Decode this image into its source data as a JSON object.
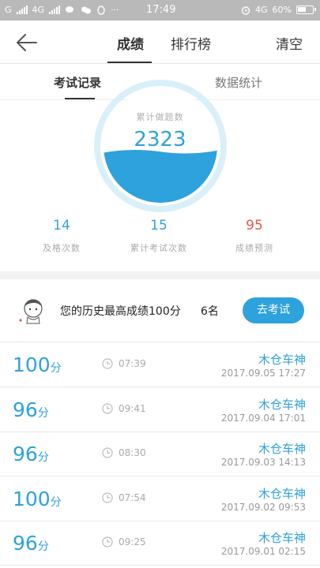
{
  "status_bar": {
    "carrier1": "G",
    "carrier2": "4G",
    "more": "···",
    "time": "17:49",
    "network": "4G",
    "battery": "60%"
  },
  "nav": {
    "tab_score": "成绩",
    "tab_rank": "排行榜",
    "clear": "清空"
  },
  "subtabs": {
    "records": "考试记录",
    "stats": "数据统计"
  },
  "gauge": {
    "label": "累计做题数",
    "value": "2323",
    "fill_level": 0.45,
    "color": "#2ea2dc"
  },
  "stats": [
    {
      "value": "14",
      "label": "及格次数",
      "color": "#2ea2dc"
    },
    {
      "value": "15",
      "label": "累计考试次数",
      "color": "#2ea2dc"
    },
    {
      "value": "95",
      "label": "成绩预测",
      "color": "#e25a4a"
    }
  ],
  "best": {
    "text": "您的历史最高成绩100分",
    "rank": "6名",
    "button": "去考试"
  },
  "records": [
    {
      "score": "100",
      "unit": "分",
      "duration": "07:39",
      "name": "木仓车神",
      "datetime": "2017.09.05  17:27"
    },
    {
      "score": "96",
      "unit": "分",
      "duration": "09:41",
      "name": "木仓车神",
      "datetime": "2017.09.04  17:01"
    },
    {
      "score": "96",
      "unit": "分",
      "duration": "08:30",
      "name": "木仓车神",
      "datetime": "2017.09.03  14:13"
    },
    {
      "score": "100",
      "unit": "分",
      "duration": "07:54",
      "name": "木仓车神",
      "datetime": "2017.09.02  09:53"
    },
    {
      "score": "96",
      "unit": "分",
      "duration": "09:25",
      "name": "木仓车神",
      "datetime": "2017.09.01  02:15"
    }
  ]
}
